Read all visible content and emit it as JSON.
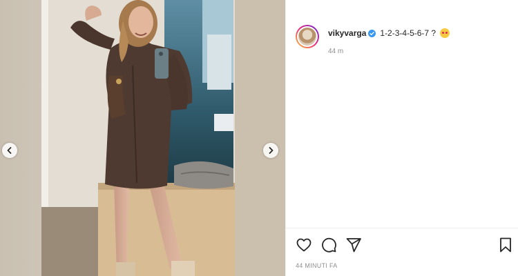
{
  "post": {
    "username": "vikyvarga",
    "caption": "1-2-3-4-5-6-7 ?",
    "relative_time": "44 m",
    "posted_time": "44 MINUTI FA"
  },
  "icons": {
    "like": "heart-icon",
    "comment": "comment-icon",
    "share": "share-icon",
    "save": "bookmark-icon",
    "verified": "verified-badge-icon",
    "nav_prev": "chevron-left-icon",
    "nav_next": "chevron-right-icon"
  },
  "colors": {
    "verified": "#3897f0",
    "text": "#262626",
    "muted": "#8e8e8e"
  }
}
